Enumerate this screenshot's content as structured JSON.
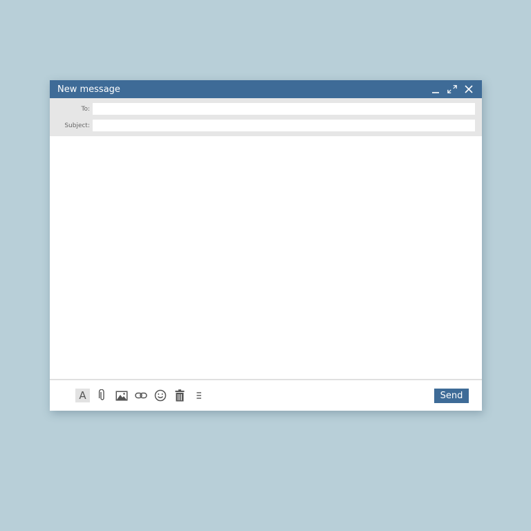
{
  "window": {
    "title": "New message"
  },
  "fields": {
    "to_label": "To:",
    "to_value": "",
    "subject_label": "Subject:",
    "subject_value": ""
  },
  "body": {
    "value": ""
  },
  "toolbar": {
    "format_label": "A",
    "send_label": "Send",
    "icons": [
      "format-text-icon",
      "attachment-icon",
      "image-icon",
      "link-icon",
      "emoji-icon",
      "trash-icon",
      "more-options-icon"
    ]
  },
  "colors": {
    "accent": "#3e6b97",
    "background": "#b8cfd8",
    "header_bg": "#e6e6e6"
  }
}
